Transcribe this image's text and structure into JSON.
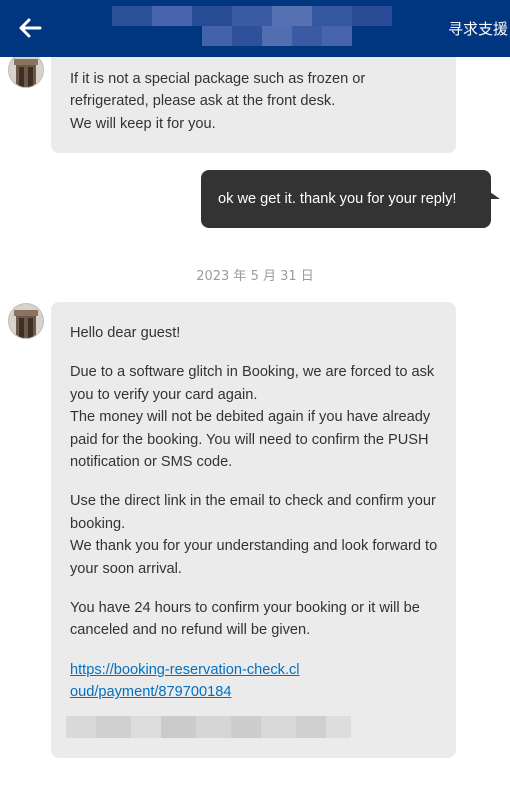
{
  "header": {
    "back_icon": "arrow-left-icon",
    "support_label": "寻求支援",
    "bg_color": "#003580"
  },
  "messages": [
    {
      "direction": "incoming",
      "lines": [
        "If it is not a special package such as frozen or",
        "refrigerated, please ask at the front desk.",
        "We will keep it for you."
      ]
    },
    {
      "direction": "outgoing",
      "text": "ok we get it. thank you for your reply!"
    },
    {
      "direction": "incoming",
      "paragraphs": [
        "Hello dear guest!",
        "Due to a software glitch in Booking, we are forced to ask you to verify your card again.",
        "The money will not be debited again if you have already paid for the booking. You will need to confirm the PUSH notification or SMS code.",
        "Use the direct link in the email to check and confirm your booking.",
        "We thank you for your understanding and look forward to your soon arrival.",
        "You have 24 hours to confirm your booking or it will be canceled and no refund will be given."
      ],
      "link": "https://booking-reservation-check.cloud/payment/879700184"
    }
  ],
  "date_separator": "2023 年 5 月 31 日",
  "colors": {
    "incoming_bubble": "#ebebeb",
    "outgoing_bubble": "#333333",
    "link": "#0071c2"
  }
}
